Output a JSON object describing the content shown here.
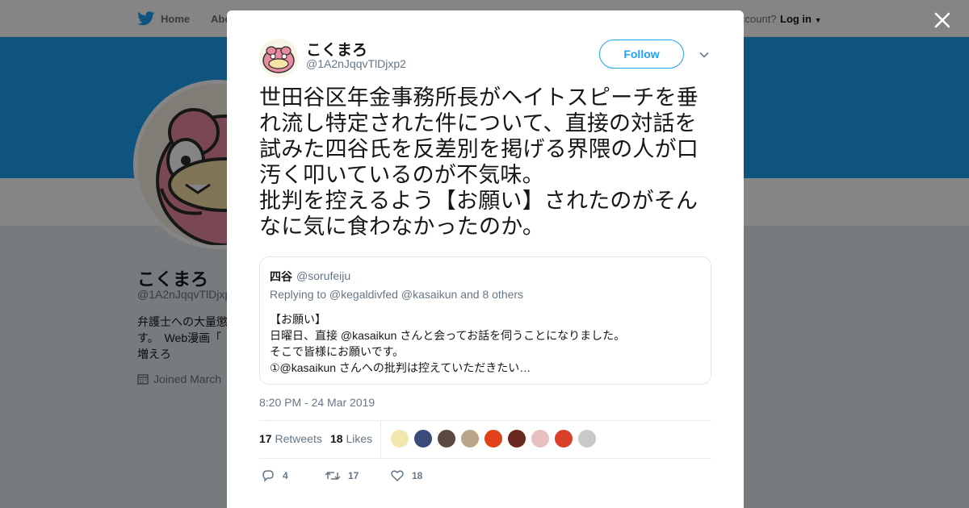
{
  "nav": {
    "home_label": "Home",
    "about_label": "Abo",
    "account_text": "ccount?",
    "login_label": "Log in"
  },
  "profile": {
    "name": "こくまろ",
    "handle": "@1A2nJqqvTlDjxp",
    "bio": "弁護士への大量懲 す。　Web漫画「 増えろ",
    "joined": "Joined March"
  },
  "tweet": {
    "display_name": "こくまろ",
    "handle": "@1A2nJqqvTlDjxp2",
    "follow_label": "Follow",
    "text": "世田谷区年金事務所長がヘイトスピーチを垂れ流し特定された件について、直接の対話を試みた四谷氏を反差別を掲げる界隈の人が口汚く叩いているのが不気味。\n批判を控えるよう【お願い】されたのがそんなに気に食わなかったのか。",
    "timestamp": "8:20 PM - 24 Mar 2019",
    "retweets_count": "17",
    "retweets_label": "Retweets",
    "likes_count": "18",
    "likes_label": "Likes",
    "actions": {
      "reply_count": "4",
      "retweet_count": "17",
      "like_count": "18"
    }
  },
  "quoted": {
    "name": "四谷",
    "handle": "@sorufeiju",
    "replying": "Replying to @kegaldivfed @kasaikun and 8 others",
    "lines": [
      "【お願い】",
      "日曜日、直接 @kasaikun さんと会ってお話を伺うことになりました。",
      "そこで皆様にお願いです。",
      "①@kasaikun さんへの批判は控えていただきたい…"
    ]
  },
  "likers": [
    "#f3e7b0",
    "#3b4a7a",
    "#5a4a3f",
    "#b8a58a",
    "#e0401a",
    "#6b2a1f",
    "#e8c0c0",
    "#d9402a",
    "#c9c9c9"
  ],
  "colors": {
    "accent": "#1da1f2",
    "text": "#14171a",
    "muted": "#657786"
  }
}
